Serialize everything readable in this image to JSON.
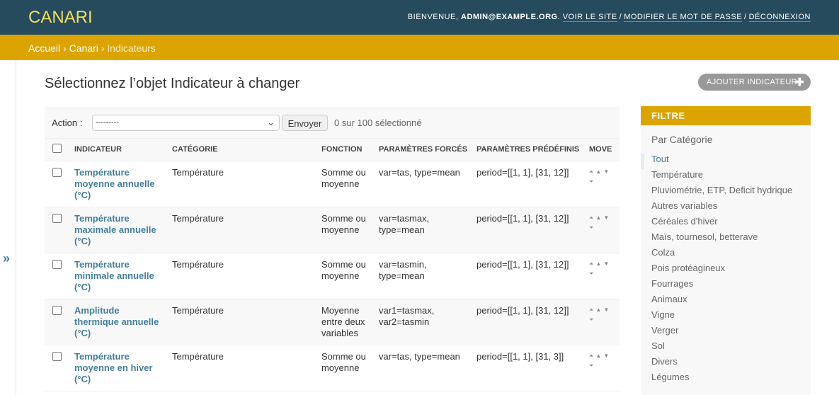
{
  "header": {
    "brand": "CANARI",
    "welcome": "Bienvenue,",
    "user": "admin@example.org",
    "view_site": "Voir le site",
    "change_password": "Modifier le mot de passe",
    "logout": "Déconnexion"
  },
  "breadcrumbs": {
    "home": "Accueil",
    "app": "Canari",
    "current": "Indicateurs"
  },
  "nav_toggle": "»",
  "page": {
    "title": "Sélectionnez l’objet Indicateur à changer",
    "add_button": "Ajouter indicateur",
    "add_icon": "plus-icon"
  },
  "actions": {
    "label": "Action :",
    "selected_option": "---------",
    "go_button": "Envoyer",
    "count": "0 sur 100 sélectionné"
  },
  "table": {
    "columns": [
      "Indicateur",
      "Catégorie",
      "Fonction",
      "Paramètres forcés",
      "Paramètres prédéfinis",
      "Move"
    ],
    "rows": [
      {
        "indicateur": [
          "Température",
          "moyenne annuelle",
          "(°C)"
        ],
        "categorie": "Température",
        "fonction": [
          "Somme ou",
          "moyenne"
        ],
        "forces": [
          "var=tas, type=mean"
        ],
        "predefinis": "period=[[1, 1], [31, 12]]"
      },
      {
        "indicateur": [
          "Température",
          "maximale annuelle",
          "(°C)"
        ],
        "categorie": "Température",
        "fonction": [
          "Somme ou",
          "moyenne"
        ],
        "forces": [
          "var=tasmax,",
          "type=mean"
        ],
        "predefinis": "period=[[1, 1], [31, 12]]"
      },
      {
        "indicateur": [
          "Température",
          "minimale annuelle",
          "(°C)"
        ],
        "categorie": "Température",
        "fonction": [
          "Somme ou",
          "moyenne"
        ],
        "forces": [
          "var=tasmin,",
          "type=mean"
        ],
        "predefinis": "period=[[1, 1], [31, 12]]"
      },
      {
        "indicateur": [
          "Amplitude",
          "thermique annuelle",
          "(°C)"
        ],
        "categorie": "Température",
        "fonction": [
          "Moyenne",
          "entre deux",
          "variables"
        ],
        "forces": [
          "var1=tasmax,",
          "var2=tasmin"
        ],
        "predefinis": "period=[[1, 1], [31, 12]]"
      },
      {
        "indicateur": [
          "Température",
          "moyenne en hiver",
          "(°C)"
        ],
        "categorie": "Température",
        "fonction": [
          "Somme ou",
          "moyenne"
        ],
        "forces": [
          "var=tas, type=mean"
        ],
        "predefinis": "period=[[1, 1], [31, 3]]"
      }
    ]
  },
  "filter": {
    "title": "Filtre",
    "by": "Par Catégorie",
    "items": [
      "Tout",
      "Température",
      "Pluviométrie, ETP, Deficit hydrique",
      "Autres variables",
      "Céréales d'hiver",
      "Maïs, tournesol, betterave",
      "Colza",
      "Pois protéagineux",
      "Fourrages",
      "Animaux",
      "Vigne",
      "Verger",
      "Sol",
      "Divers",
      "Légumes"
    ],
    "selected": "Tout"
  }
}
